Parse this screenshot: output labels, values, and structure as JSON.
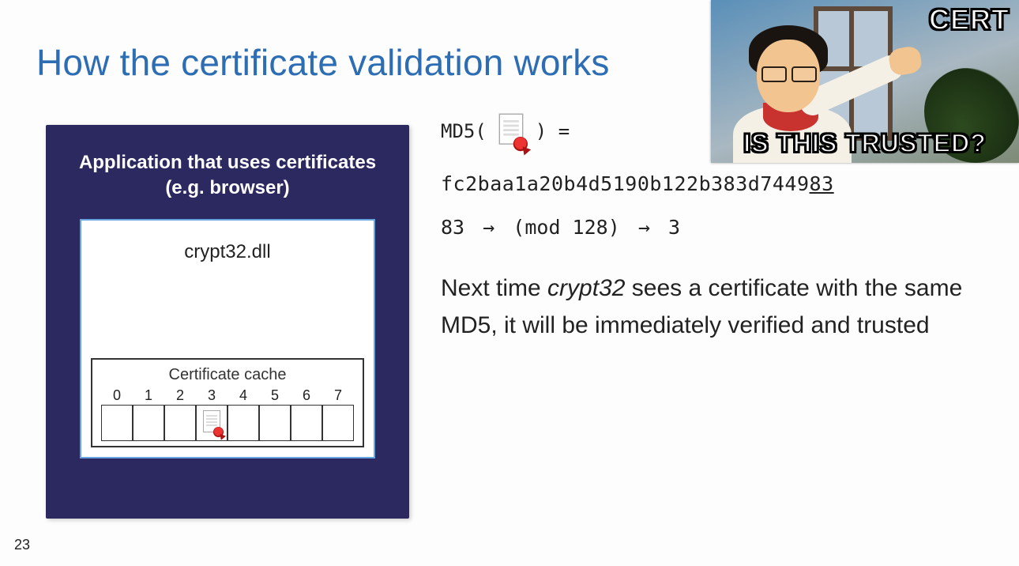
{
  "title": "How the certificate validation works",
  "slide_number": "23",
  "diagram": {
    "header": "Application that uses certificates\n(e.g. browser)",
    "crypt_label": "crypt32.dll",
    "cache_title": "Certificate cache",
    "indices": [
      "0",
      "1",
      "2",
      "3",
      "4",
      "5",
      "6",
      "7"
    ],
    "filled_index": 3
  },
  "right": {
    "md5_prefix": "MD5(",
    "md5_suffix": ")  =",
    "hash_prefix": "fc2baa1a20b4d5190b122b383d7449",
    "hash_underlined": "83",
    "mod_before": "83",
    "mod_mid": "(mod 128)",
    "mod_after": "3",
    "explanation_before": "Next time ",
    "explanation_em": "crypt32",
    "explanation_after": " sees a certificate with the same MD5, it will be immediately verified and trusted"
  },
  "meme": {
    "top": "CERT",
    "bottom": "IS THIS TRUSTED?"
  }
}
